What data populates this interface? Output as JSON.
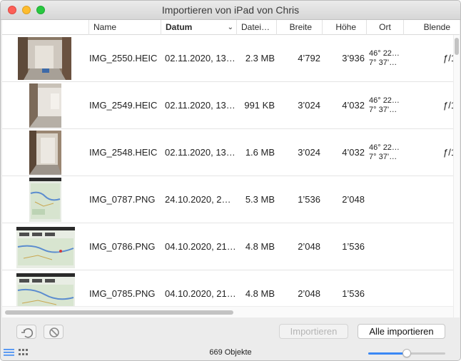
{
  "window": {
    "title": "Importieren von iPad von Chris"
  },
  "table": {
    "columns": {
      "name": "Name",
      "datum": "Datum",
      "dateigroesse": "Datei…",
      "breite": "Breite",
      "hoehe": "Höhe",
      "ort": "Ort",
      "blende": "Blende"
    },
    "rows": [
      {
        "name": "IMG_2550.HEIC",
        "date": "02.11.2020, 13…",
        "size": "2.3 MB",
        "width": "4’792",
        "height": "3’936",
        "ort1": "46° 22…",
        "ort2": "7° 37’…",
        "blende": "ƒ/1"
      },
      {
        "name": "IMG_2549.HEIC",
        "date": "02.11.2020, 13…",
        "size": "991 KB",
        "width": "3’024",
        "height": "4’032",
        "ort1": "46° 22…",
        "ort2": "7° 37’…",
        "blende": "ƒ/1"
      },
      {
        "name": "IMG_2548.HEIC",
        "date": "02.11.2020, 13…",
        "size": "1.6 MB",
        "width": "3’024",
        "height": "4’032",
        "ort1": "46° 22…",
        "ort2": "7° 37’…",
        "blende": "ƒ/1"
      },
      {
        "name": "IMG_0787.PNG",
        "date": "24.10.2020, 2…",
        "size": "5.3 MB",
        "width": "1’536",
        "height": "2’048",
        "ort1": "",
        "ort2": "",
        "blende": ""
      },
      {
        "name": "IMG_0786.PNG",
        "date": "04.10.2020, 21…",
        "size": "4.8 MB",
        "width": "2’048",
        "height": "1’536",
        "ort1": "",
        "ort2": "",
        "blende": ""
      },
      {
        "name": "IMG_0785.PNG",
        "date": "04.10.2020, 21…",
        "size": "4.8 MB",
        "width": "2’048",
        "height": "1’536",
        "ort1": "",
        "ort2": "",
        "blende": ""
      }
    ]
  },
  "toolbar": {
    "rotate_icon": "rotate-left-icon",
    "delete_icon": "no-entry-icon",
    "import_label": "Importieren",
    "import_all_label": "Alle importieren"
  },
  "status": {
    "count_label": "669 Objekte",
    "thumbnail_size": 0.5
  },
  "colors": {
    "accent": "#3b88f5",
    "close": "#fc5f57",
    "minimize": "#fdbc2e",
    "maximize": "#28c840"
  }
}
